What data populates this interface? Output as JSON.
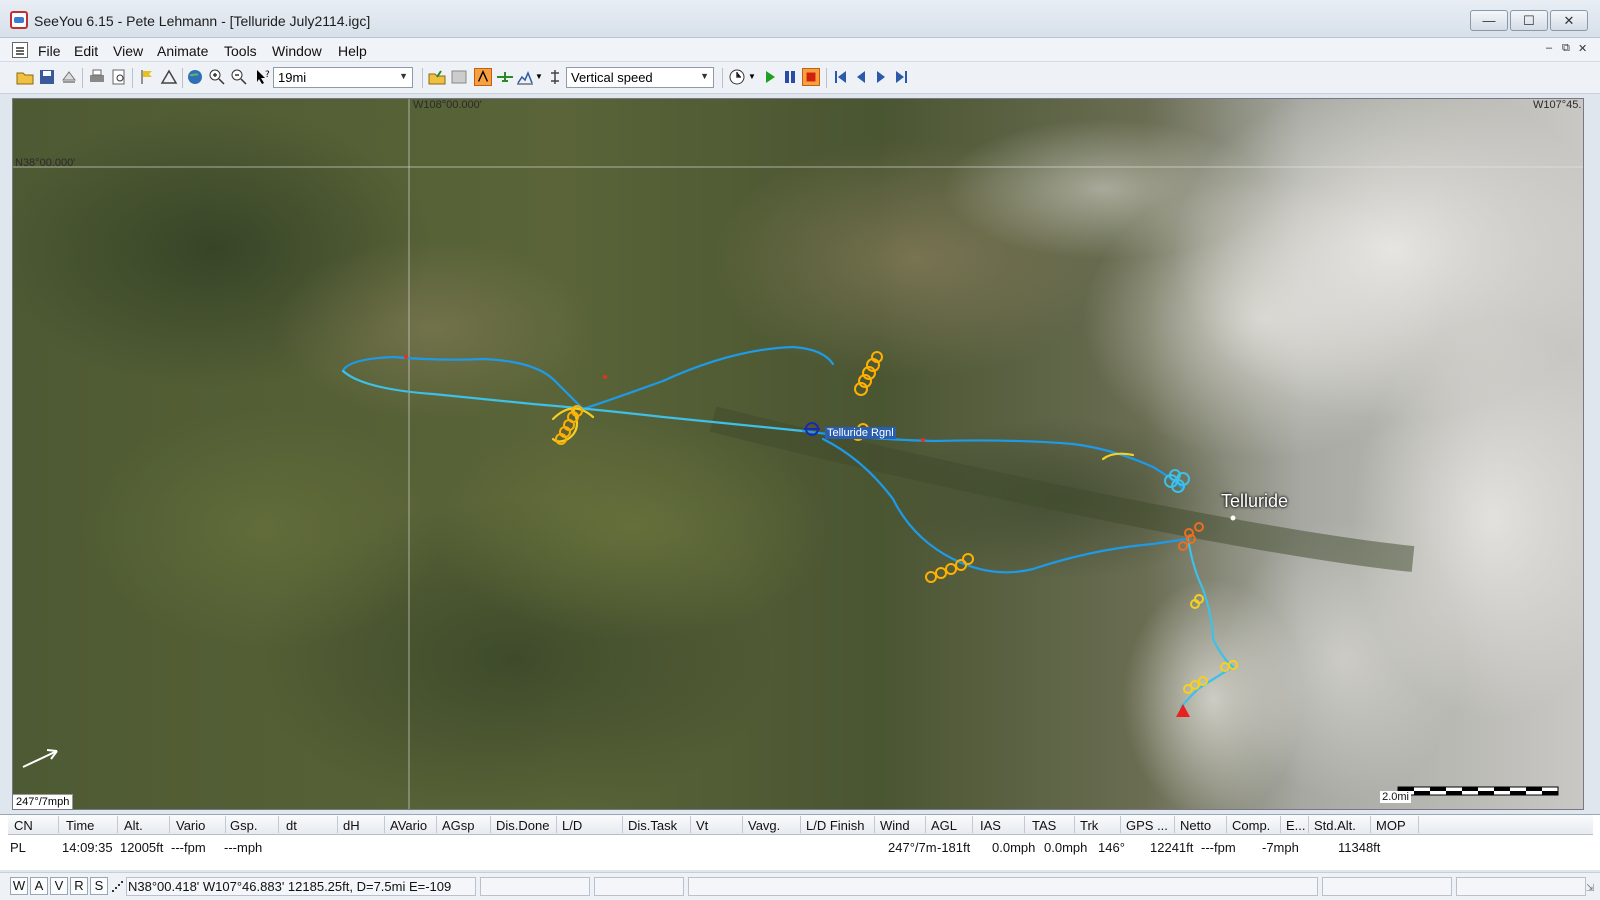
{
  "window": {
    "title": "SeeYou 6.15 - Pete Lehmann - [Telluride July2114.igc]",
    "controls": [
      "minimize",
      "maximize",
      "close"
    ]
  },
  "menu": {
    "items": [
      "File",
      "Edit",
      "View",
      "Animate",
      "Tools",
      "Window",
      "Help"
    ]
  },
  "toolbar": {
    "zoom_combo_value": "19mi",
    "color_mode_combo_value": "Vertical speed"
  },
  "map": {
    "lon_label_left": "W108°00.000'",
    "lon_label_right": "W107°45.",
    "lat_label": "N38°00.000'",
    "wind_label": "247°/7mph",
    "scale_label": "2.0mi",
    "city_label": "Telluride",
    "airport_label": "Telluride Rgnl"
  },
  "table": {
    "columns": [
      "CN",
      "Time",
      "Alt.",
      "Vario",
      "Gsp.",
      "dt",
      "dH",
      "AVario",
      "AGsp",
      "Dis.Done",
      "L/D",
      "Dis.Task",
      "Vt",
      "Vavg.",
      "L/D Finish",
      "Wind",
      "AGL",
      "IAS",
      "TAS",
      "Trk",
      "GPS ...",
      "Netto",
      "Comp.",
      "E...",
      "Std.Alt.",
      "MOP"
    ],
    "row": {
      "cn": "PL",
      "time": "14:09:35",
      "alt": "12005ft",
      "vario": "---fpm",
      "gsp": "---mph",
      "wind": "247°/7m",
      "agl": "-181ft",
      "ias": "0.0mph",
      "tas": "0.0mph",
      "trk": "146°",
      "gps": "12241ft",
      "netto": "---fpm",
      "comp": "-7mph",
      "std_alt": "11348ft"
    }
  },
  "statusbar": {
    "buttons": [
      "W",
      "A",
      "V",
      "R",
      "S"
    ],
    "coords": "N38°00.418'  W107°46.883' 12185.25ft, D=7.5mi E=-109"
  },
  "colors": {
    "track_climb_strong": "#ffb000",
    "track_climb": "#f5d020",
    "track_sink": "#1e9be8",
    "track_neutral": "#3ec0e8",
    "track_peak": "#e83020"
  }
}
